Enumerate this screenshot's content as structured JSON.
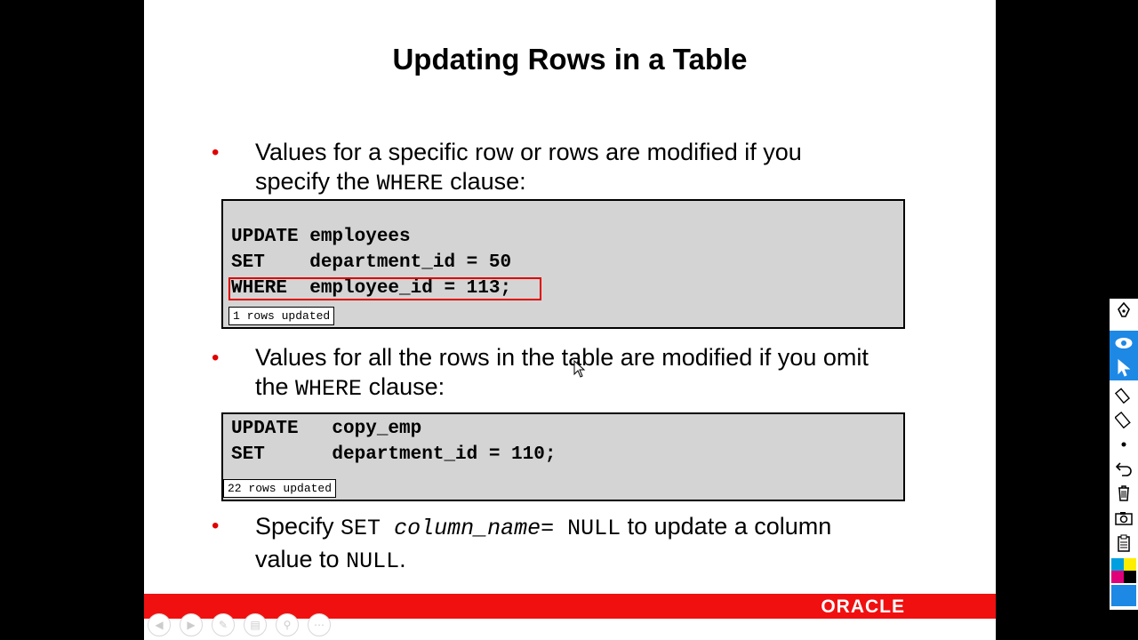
{
  "slide": {
    "title": "Updating Rows in a Table",
    "bullet_marker": "•",
    "bullet1": {
      "line1": "Values for a specific row or rows are modified if you",
      "line2_pre": "specify the ",
      "line2_code": "WHERE",
      "line2_post": " clause:"
    },
    "code1": {
      "line1": "UPDATE employees",
      "line2": "SET    department_id = 50",
      "line3": "WHERE  employee_id = 113;",
      "result": "1 rows updated"
    },
    "bullet2": {
      "line1": "Values for all the rows in the table are modified if you omit",
      "line2_pre": "the ",
      "line2_code": "WHERE",
      "line2_post": " clause:"
    },
    "code2": {
      "line1": "UPDATE   copy_emp",
      "line2": "SET      department_id = 110;",
      "result": "22 rows updated"
    },
    "bullet3": {
      "pre": "Specify ",
      "code1": "SET ",
      "italic": "column_name",
      "code2": "= NULL",
      "post": " to update a column",
      "line2_pre": "value to ",
      "line2_code": "NULL",
      "line2_post": "."
    },
    "footer_logo": "ORACLE"
  },
  "nav_buttons": [
    "prev-icon",
    "next-icon",
    "pen-icon",
    "pages-icon",
    "zoom-icon",
    "more-icon"
  ],
  "toolbar": {
    "tools": [
      "pen-icon",
      "eye-icon",
      "pointer-icon",
      "highlighter-icon",
      "eraser-icon",
      "dot-icon",
      "undo-icon",
      "trash-icon",
      "camera-icon",
      "clipboard-icon"
    ],
    "colors": [
      "#00a0e0",
      "#ffee00",
      "#e0007a",
      "#000000",
      "#1e88e5"
    ]
  }
}
